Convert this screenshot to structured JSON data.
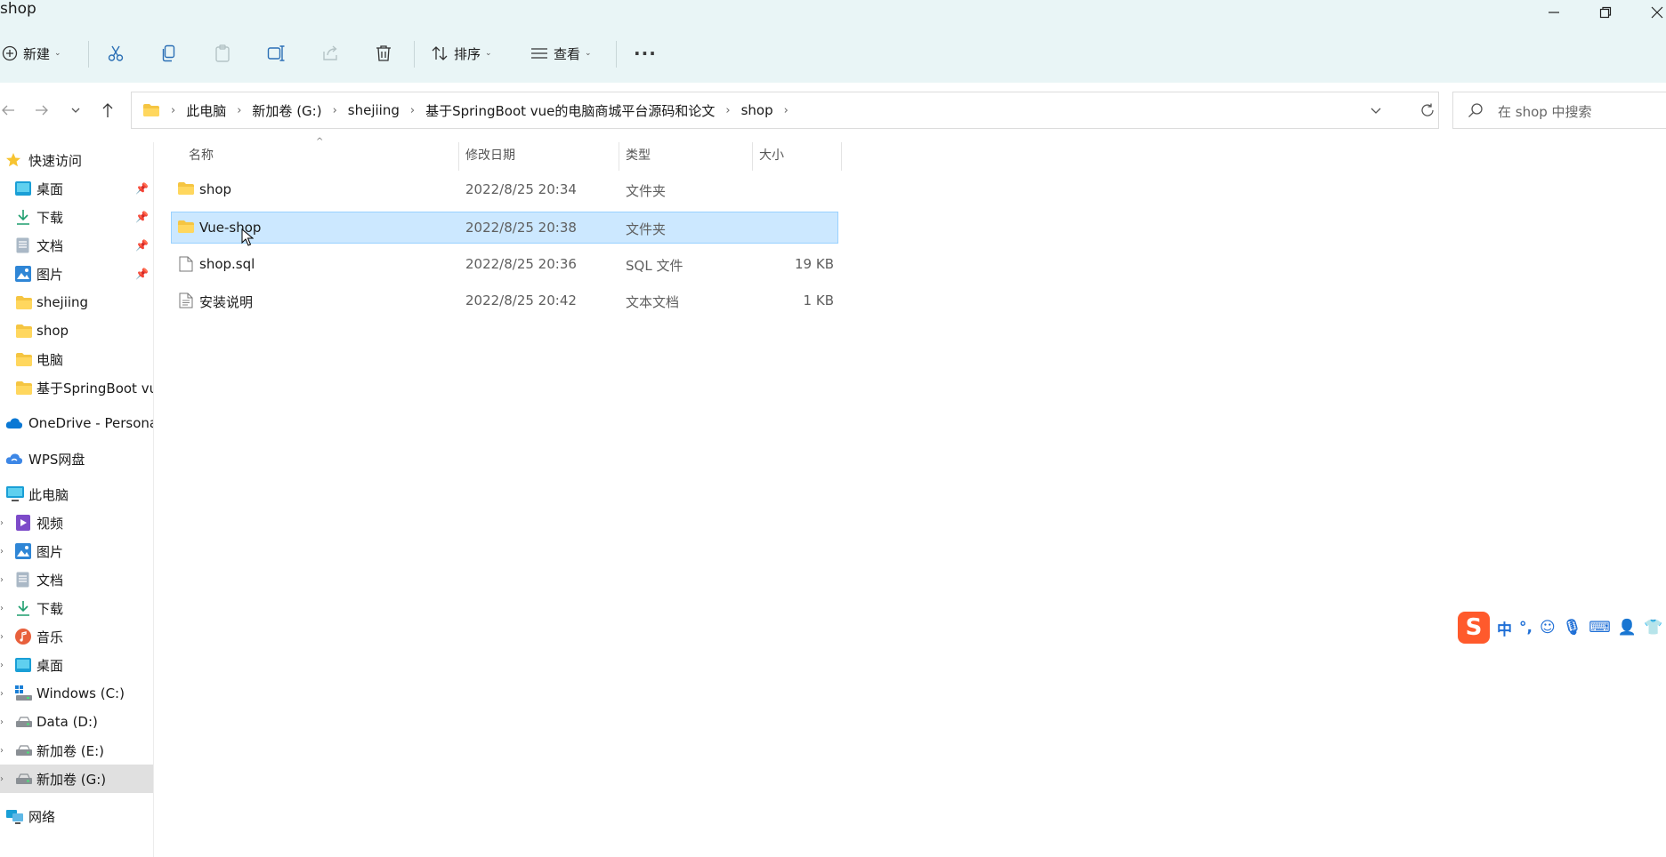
{
  "window": {
    "title": "shop"
  },
  "toolbar": {
    "new_label": "新建",
    "sort_label": "排序",
    "view_label": "查看",
    "more_label": "···"
  },
  "breadcrumb": [
    "此电脑",
    "新加卷 (G:)",
    "shejiing",
    "基于SpringBoot vue的电脑商城平台源码和论文",
    "shop"
  ],
  "search": {
    "placeholder": "在 shop 中搜索"
  },
  "sidebar": {
    "quick_access": "快速访问",
    "items": [
      {
        "label": "桌面"
      },
      {
        "label": "下载"
      },
      {
        "label": "文档"
      },
      {
        "label": "图片"
      },
      {
        "label": "shejiing"
      },
      {
        "label": "shop"
      },
      {
        "label": "电脑"
      },
      {
        "label": "基于SpringBoot vue的电脑商城平台源码和论文"
      }
    ],
    "onedrive": "OneDrive - Personal",
    "wps": "WPS网盘",
    "this_pc": "此电脑",
    "pc_items": [
      {
        "label": "视频"
      },
      {
        "label": "图片"
      },
      {
        "label": "文档"
      },
      {
        "label": "下载"
      },
      {
        "label": "音乐"
      },
      {
        "label": "桌面"
      },
      {
        "label": "Windows (C:)"
      },
      {
        "label": "Data (D:)"
      },
      {
        "label": "新加卷 (E:)"
      },
      {
        "label": "新加卷 (G:)"
      }
    ],
    "network": "网络"
  },
  "columns": {
    "name": "名称",
    "modified": "修改日期",
    "type": "类型",
    "size": "大小"
  },
  "files": [
    {
      "name": "shop",
      "modified": "2022/8/25 20:34",
      "type": "文件夹",
      "size": "",
      "icon": "folder-icon"
    },
    {
      "name": "Vue-shop",
      "modified": "2022/8/25 20:38",
      "type": "文件夹",
      "size": "",
      "icon": "folder-icon"
    },
    {
      "name": "shop.sql",
      "modified": "2022/8/25 20:36",
      "type": "SQL 文件",
      "size": "19 KB",
      "icon": "file-icon"
    },
    {
      "name": "安装说明",
      "modified": "2022/8/25 20:42",
      "type": "文本文档",
      "size": "1 KB",
      "icon": "text-file-icon"
    }
  ],
  "ime": {
    "logo": "S",
    "mode": "中"
  }
}
